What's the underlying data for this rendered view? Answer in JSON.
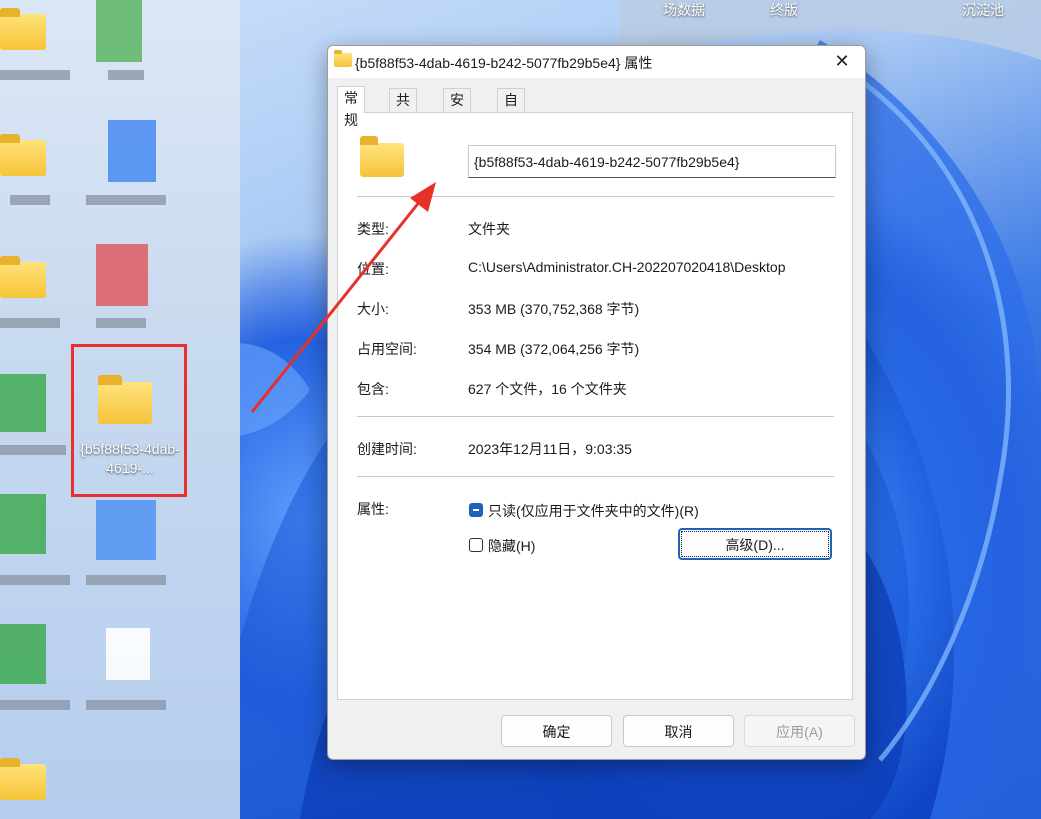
{
  "desktop": {
    "top_labels": [
      "场数据",
      "终版",
      "沉淀池"
    ],
    "highlighted_folder_label": "{b5f88f53-4dab-4619-..."
  },
  "dialog": {
    "title": "{b5f88f53-4dab-4619-b242-5077fb29b5e4} 属性",
    "close_symbol": "✕",
    "tabs": [
      "常规",
      "共享",
      "安全",
      "自定义"
    ],
    "folder_name": "{b5f88f53-4dab-4619-b242-5077fb29b5e4}",
    "rows": {
      "type_label": "类型:",
      "type_value": "文件夹",
      "location_label": "位置:",
      "location_value": "C:\\Users\\Administrator.CH-202207020418\\Desktop",
      "size_label": "大小:",
      "size_value": "353 MB (370,752,368 字节)",
      "disk_label": "占用空间:",
      "disk_value": "354 MB (372,064,256 字节)",
      "contains_label": "包含:",
      "contains_value": "627 个文件，16 个文件夹",
      "created_label": "创建时间:",
      "created_value": "2023年12月11日，9:03:35",
      "attributes_label": "属性:"
    },
    "attributes": {
      "readonly_label": "只读(仅应用于文件夹中的文件)(R)",
      "readonly_state": "indeterminate",
      "hidden_label": "隐藏(H)",
      "hidden_state": "unchecked",
      "advanced_button": "高级(D)..."
    },
    "buttons": {
      "ok": "确定",
      "cancel": "取消",
      "apply": "应用(A)"
    }
  },
  "colors": {
    "annotation_red": "#e8302a",
    "accent_blue": "#1f62b9"
  }
}
